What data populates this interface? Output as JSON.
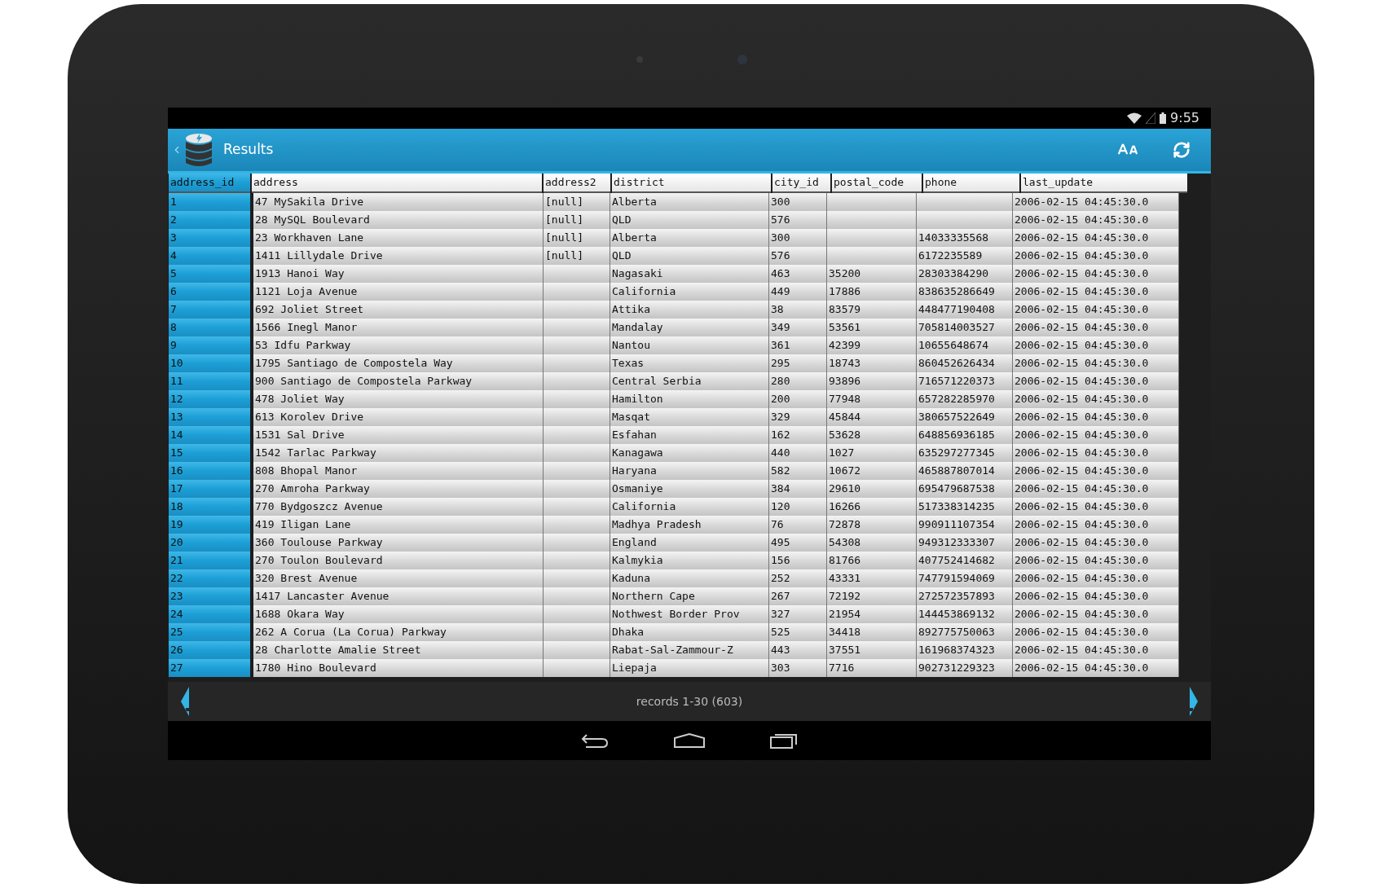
{
  "status_bar": {
    "time": "9:55"
  },
  "action_bar": {
    "title": "Results"
  },
  "table": {
    "columns": [
      "address_id",
      "address",
      "address2",
      "district",
      "city_id",
      "postal_code",
      "phone",
      "last_update"
    ],
    "rows": [
      [
        "1",
        "47 MySakila Drive",
        "[null]",
        "Alberta",
        "300",
        "",
        "",
        "2006-02-15 04:45:30.0"
      ],
      [
        "2",
        "28 MySQL Boulevard",
        "[null]",
        "QLD",
        "576",
        "",
        "",
        "2006-02-15 04:45:30.0"
      ],
      [
        "3",
        "23 Workhaven Lane",
        "[null]",
        "Alberta",
        "300",
        "",
        "14033335568",
        "2006-02-15 04:45:30.0"
      ],
      [
        "4",
        "1411 Lillydale Drive",
        "[null]",
        "QLD",
        "576",
        "",
        "6172235589",
        "2006-02-15 04:45:30.0"
      ],
      [
        "5",
        "1913 Hanoi Way",
        "",
        "Nagasaki",
        "463",
        "35200",
        "28303384290",
        "2006-02-15 04:45:30.0"
      ],
      [
        "6",
        "1121 Loja Avenue",
        "",
        "California",
        "449",
        "17886",
        "838635286649",
        "2006-02-15 04:45:30.0"
      ],
      [
        "7",
        "692 Joliet Street",
        "",
        "Attika",
        "38",
        "83579",
        "448477190408",
        "2006-02-15 04:45:30.0"
      ],
      [
        "8",
        "1566 Inegl Manor",
        "",
        "Mandalay",
        "349",
        "53561",
        "705814003527",
        "2006-02-15 04:45:30.0"
      ],
      [
        "9",
        "53 Idfu Parkway",
        "",
        "Nantou",
        "361",
        "42399",
        "10655648674",
        "2006-02-15 04:45:30.0"
      ],
      [
        "10",
        "1795 Santiago de Compostela Way",
        "",
        "Texas",
        "295",
        "18743",
        "860452626434",
        "2006-02-15 04:45:30.0"
      ],
      [
        "11",
        "900 Santiago de Compostela Parkway",
        "",
        "Central Serbia",
        "280",
        "93896",
        "716571220373",
        "2006-02-15 04:45:30.0"
      ],
      [
        "12",
        "478 Joliet Way",
        "",
        "Hamilton",
        "200",
        "77948",
        "657282285970",
        "2006-02-15 04:45:30.0"
      ],
      [
        "13",
        "613 Korolev Drive",
        "",
        "Masqat",
        "329",
        "45844",
        "380657522649",
        "2006-02-15 04:45:30.0"
      ],
      [
        "14",
        "1531 Sal Drive",
        "",
        "Esfahan",
        "162",
        "53628",
        "648856936185",
        "2006-02-15 04:45:30.0"
      ],
      [
        "15",
        "1542 Tarlac Parkway",
        "",
        "Kanagawa",
        "440",
        "1027",
        "635297277345",
        "2006-02-15 04:45:30.0"
      ],
      [
        "16",
        "808 Bhopal Manor",
        "",
        "Haryana",
        "582",
        "10672",
        "465887807014",
        "2006-02-15 04:45:30.0"
      ],
      [
        "17",
        "270 Amroha Parkway",
        "",
        "Osmaniye",
        "384",
        "29610",
        "695479687538",
        "2006-02-15 04:45:30.0"
      ],
      [
        "18",
        "770 Bydgoszcz Avenue",
        "",
        "California",
        "120",
        "16266",
        "517338314235",
        "2006-02-15 04:45:30.0"
      ],
      [
        "19",
        "419 Iligan Lane",
        "",
        "Madhya Pradesh",
        "76",
        "72878",
        "990911107354",
        "2006-02-15 04:45:30.0"
      ],
      [
        "20",
        "360 Toulouse Parkway",
        "",
        "England",
        "495",
        "54308",
        "949312333307",
        "2006-02-15 04:45:30.0"
      ],
      [
        "21",
        "270 Toulon Boulevard",
        "",
        "Kalmykia",
        "156",
        "81766",
        "407752414682",
        "2006-02-15 04:45:30.0"
      ],
      [
        "22",
        "320 Brest Avenue",
        "",
        "Kaduna",
        "252",
        "43331",
        "747791594069",
        "2006-02-15 04:45:30.0"
      ],
      [
        "23",
        "1417 Lancaster Avenue",
        "",
        "Northern Cape",
        "267",
        "72192",
        "272572357893",
        "2006-02-15 04:45:30.0"
      ],
      [
        "24",
        "1688 Okara Way",
        "",
        "Nothwest Border Prov",
        "327",
        "21954",
        "144453869132",
        "2006-02-15 04:45:30.0"
      ],
      [
        "25",
        "262 A Corua (La Corua) Parkway",
        "",
        "Dhaka",
        "525",
        "34418",
        "892775750063",
        "2006-02-15 04:45:30.0"
      ],
      [
        "26",
        "28 Charlotte Amalie Street",
        "",
        "Rabat-Sal-Zammour-Z",
        "443",
        "37551",
        "161968374323",
        "2006-02-15 04:45:30.0"
      ],
      [
        "27",
        "1780 Hino Boulevard",
        "",
        "Liepaja",
        "303",
        "7716",
        "902731229323",
        "2006-02-15 04:45:30.0"
      ]
    ]
  },
  "footer": {
    "records": "records 1-30 (603)"
  }
}
